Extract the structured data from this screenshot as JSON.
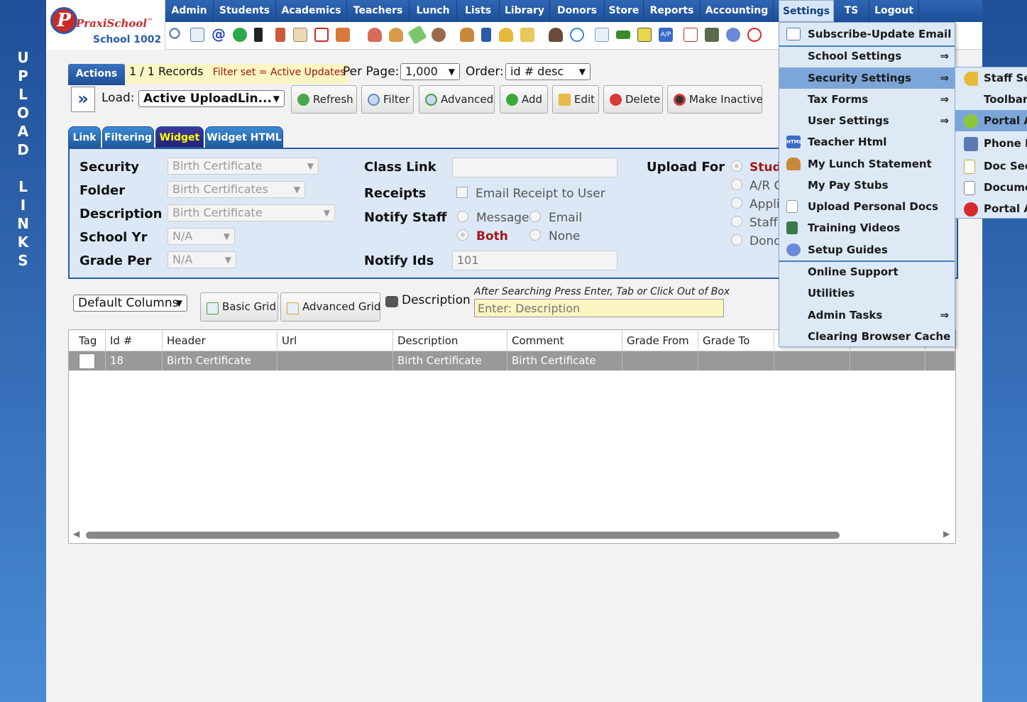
{
  "sidebar": {
    "title_letters": [
      "U",
      "P",
      "L",
      "O",
      "A",
      "D",
      "",
      "L",
      "I",
      "N",
      "K",
      "S"
    ]
  },
  "logo": {
    "letter": "P",
    "name": "PraxiSchool",
    "tm": "™",
    "school": "School 1002"
  },
  "nav": {
    "items": [
      "Admin",
      "Students",
      "Academics",
      "Teachers",
      "Lunch",
      "Lists",
      "Library",
      "Donors",
      "Store",
      "Reports",
      "Accounting",
      "Settings",
      "TS",
      "Logout"
    ],
    "active": "Settings"
  },
  "toolbar_icons": [
    "search-icon",
    "grid-icon",
    "at-icon",
    "chat-icon",
    "phone-icon",
    "speaker-icon",
    "calculator-icon",
    "calendar-icon",
    "megaphone-icon",
    "teacher-icon",
    "student-icon",
    "money-icon",
    "parents-icon",
    "burger-icon",
    "book-icon",
    "bell-icon",
    "export-icon",
    "person-icon",
    "clock-icon",
    "list-icon",
    "card-icon",
    "printer-icon",
    "ap-icon",
    "pdf-icon",
    "cash-icon",
    "help-icon",
    "stop-icon"
  ],
  "ap_label": "A/P",
  "records": {
    "actions_label": "Actions",
    "count": "1 / 1 Records",
    "filter_prefix": "Filter set = ",
    "filter_value": "Active Updates",
    "per_page_label": "Per Page:",
    "per_page_value": "1,000",
    "order_label": "Order:",
    "order_value": "id # desc"
  },
  "load": {
    "label": "Load:",
    "value": "Active UploadLin..."
  },
  "buttons": {
    "refresh": "Refresh",
    "filter": "Filter",
    "advanced": "Advanced",
    "add": "Add",
    "edit": "Edit",
    "delete": "Delete",
    "make_inactive": "Make Inactive"
  },
  "tabs": [
    "Link",
    "Filtering",
    "Widget",
    "Widget HTML"
  ],
  "active_tab": "Widget",
  "form": {
    "security_label": "Security",
    "security_value": "Birth Certificate",
    "folder_label": "Folder",
    "folder_value": "Birth Certificates",
    "description_label": "Description",
    "description_value": "Birth Certificate",
    "school_yr_label": "School Yr",
    "school_yr_value": "N/A",
    "grade_per_label": "Grade Per",
    "grade_per_value": "N/A",
    "class_link_label": "Class Link",
    "class_link_value": "",
    "receipts_label": "Receipts",
    "receipt_checkbox_label": "Email Receipt to User",
    "notify_staff_label": "Notify Staff",
    "notify_options": [
      "Message",
      "Email",
      "Both",
      "None"
    ],
    "notify_selected": "Both",
    "notify_ids_label": "Notify Ids",
    "notify_ids_value": "101",
    "upload_for_label": "Upload For",
    "upload_for_options": [
      "Stud",
      "A/R C",
      "Applic",
      "Staff",
      "Dono"
    ],
    "upload_for_selected": "Stud"
  },
  "search": {
    "columns_value": "Default Columns",
    "basic_grid": "Basic Grid",
    "advanced_grid": "Advanced Grid",
    "field_label": "Description",
    "hint": "After Searching Press Enter, Tab or Click Out of Box",
    "placeholder": "Enter: Description"
  },
  "grid": {
    "columns": [
      "Tag",
      "Id #",
      "Header",
      "Url",
      "Description",
      "Comment",
      "Grade From",
      "Grade To",
      "",
      "",
      ""
    ],
    "rows": [
      {
        "tag": "",
        "id": "18",
        "header": "Birth Certificate",
        "url": "",
        "description": "Birth Certificate",
        "comment": "Birth Certificate",
        "grade_from": "",
        "grade_to": ""
      }
    ]
  },
  "settings_menu": [
    {
      "label": "Subscribe-Update Email",
      "icon": "email-icon",
      "arrow": ""
    },
    {
      "label": "School Settings",
      "icon": "",
      "arrow": "⇒"
    },
    {
      "label": "Security Settings",
      "icon": "",
      "arrow": "⇒"
    },
    {
      "label": "Tax Forms",
      "icon": "",
      "arrow": "⇒"
    },
    {
      "label": "User Settings",
      "icon": "",
      "arrow": "⇒"
    },
    {
      "label": "Teacher Html",
      "icon": "html-icon",
      "arrow": ""
    },
    {
      "label": "My Lunch Statement",
      "icon": "burger-icon",
      "arrow": ""
    },
    {
      "label": "My Pay Stubs",
      "icon": "",
      "arrow": ""
    },
    {
      "label": "Upload Personal Docs",
      "icon": "document-icon",
      "arrow": ""
    },
    {
      "label": "Training Videos",
      "icon": "film-icon",
      "arrow": ""
    },
    {
      "label": "Setup Guides",
      "icon": "help-icon",
      "arrow": ""
    },
    {
      "label": "Online Support",
      "icon": "",
      "arrow": ""
    },
    {
      "label": "Utilities",
      "icon": "",
      "arrow": ""
    },
    {
      "label": "Admin Tasks",
      "icon": "",
      "arrow": "⇒"
    },
    {
      "label": "Clearing Browser Cache",
      "icon": "",
      "arrow": ""
    }
  ],
  "html_icon_label": "HTML",
  "security_submenu": [
    {
      "label": "Staff Se",
      "icon": "key-icon"
    },
    {
      "label": "Toolbars",
      "icon": ""
    },
    {
      "label": "Portal A",
      "icon": "portal-icon"
    },
    {
      "label": "Phone N",
      "icon": "phone-icon"
    },
    {
      "label": "Doc Sec",
      "icon": "doc-icon"
    },
    {
      "label": "Docume",
      "icon": "doc-gear-icon"
    },
    {
      "label": "Portal A",
      "icon": "alert-icon"
    }
  ],
  "colors": {
    "nav_blue": "#1f4f98",
    "panel_bg": "#dce8f5",
    "menu_bg": "#dde9f5",
    "highlight": "#7ca6d9",
    "accent_red": "#a01818",
    "hint_bg": "#fbf5c2"
  }
}
